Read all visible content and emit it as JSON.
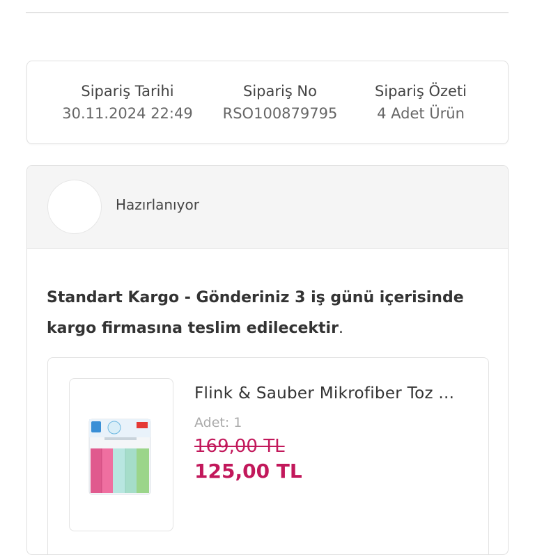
{
  "summary": {
    "date_label": "Sipariş Tarihi",
    "date_value": "30.11.2024 22:49",
    "no_label": "Sipariş No",
    "no_value": "RSO100879795",
    "overview_label": "Sipariş Özeti",
    "overview_value": "4 Adet Ürün"
  },
  "order": {
    "status": "Hazırlanıyor",
    "shipping_bold": "Standart Kargo - Gönderiniz 3 iş günü içerisinde kargo firmasına teslim edilecektir",
    "shipping_tail": ".",
    "product": {
      "name": "Flink & Sauber Mikrofiber Toz ...",
      "quantity": "Adet: 1",
      "old_price": "169,00 TL",
      "new_price": "125,00 TL",
      "image_icon": "microfiber-cloth-pack-image"
    }
  },
  "colors": {
    "price": "#c2185b",
    "border": "#e0e0e0",
    "status_bg": "#f5f5f5"
  }
}
